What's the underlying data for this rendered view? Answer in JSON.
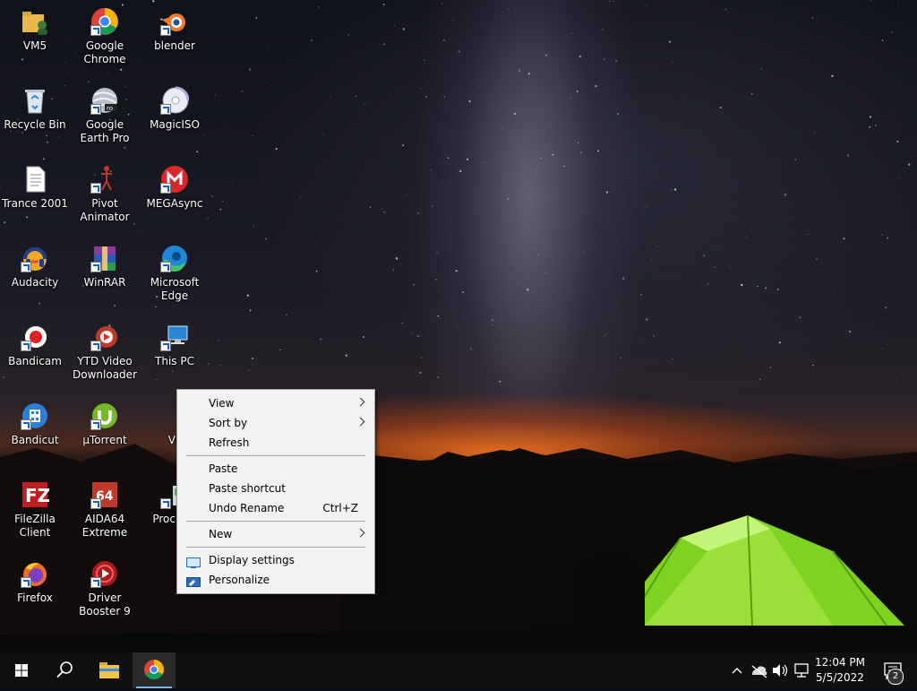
{
  "desktop": {
    "icons": [
      {
        "label": "VM5",
        "icon": "folder-user-icon"
      },
      {
        "label": "Google Chrome",
        "icon": "chrome-icon"
      },
      {
        "label": "blender",
        "icon": "blender-icon"
      },
      {
        "label": "Recycle Bin",
        "icon": "recycle-bin-icon"
      },
      {
        "label": "Google Earth Pro",
        "icon": "google-earth-icon"
      },
      {
        "label": "MagicISO",
        "icon": "magiciso-icon"
      },
      {
        "label": "Trance 2001",
        "icon": "document-icon"
      },
      {
        "label": "Pivot Animator",
        "icon": "pivot-icon"
      },
      {
        "label": "MEGAsync",
        "icon": "mega-icon"
      },
      {
        "label": "Audacity",
        "icon": "audacity-icon"
      },
      {
        "label": "WinRAR",
        "icon": "winrar-icon"
      },
      {
        "label": "Microsoft Edge",
        "icon": "edge-icon"
      },
      {
        "label": "Bandicam",
        "icon": "bandicam-icon"
      },
      {
        "label": "YTD Video Downloader",
        "icon": "ytd-icon"
      },
      {
        "label": "This PC",
        "icon": "this-pc-icon"
      },
      {
        "label": "Bandicut",
        "icon": "bandicut-icon"
      },
      {
        "label": "µTorrent",
        "icon": "utorrent-icon"
      },
      {
        "label": "VM",
        "icon": "folder-icon"
      },
      {
        "label": "FileZilla Client",
        "icon": "filezilla-icon"
      },
      {
        "label": "AIDA64 Extreme",
        "icon": "aida64-icon"
      },
      {
        "label": "Proc Hack",
        "icon": "process-hacker-icon"
      },
      {
        "label": "Firefox",
        "icon": "firefox-icon"
      },
      {
        "label": "Driver Booster 9",
        "icon": "driver-booster-icon"
      }
    ]
  },
  "context_menu": {
    "view": "View",
    "sort_by": "Sort by",
    "refresh": "Refresh",
    "paste": "Paste",
    "paste_shortcut": "Paste shortcut",
    "undo_rename": "Undo Rename",
    "undo_rename_shortcut": "Ctrl+Z",
    "new": "New",
    "display_settings": "Display settings",
    "personalize": "Personalize"
  },
  "taskbar": {
    "apps": [
      "start-icon",
      "search-icon",
      "file-explorer-icon",
      "chrome-icon"
    ],
    "clock_time": "12:04 PM",
    "clock_date": "5/5/2022",
    "notification_count": "2"
  },
  "colors": {
    "menu_bg": "#f2f2f2",
    "taskbar_bg": "#101010",
    "accent": "#0078d7"
  }
}
